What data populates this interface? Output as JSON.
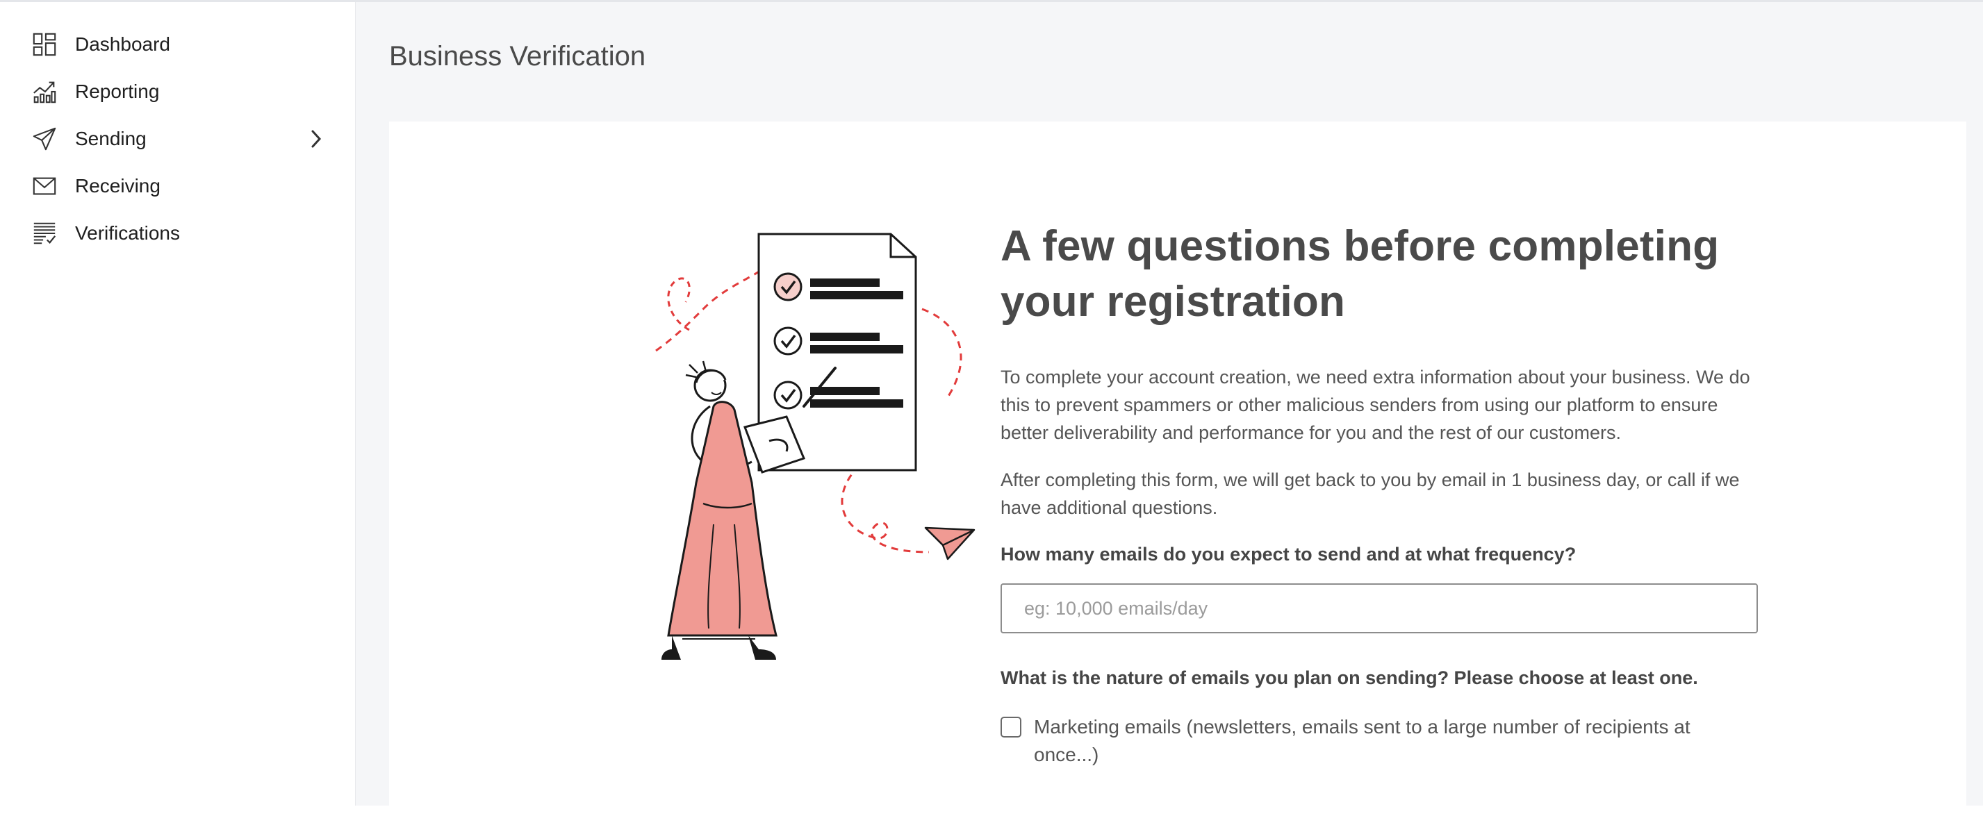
{
  "sidebar": {
    "items": [
      {
        "label": "Dashboard",
        "icon": "dashboard-icon"
      },
      {
        "label": "Reporting",
        "icon": "reporting-chart-icon"
      },
      {
        "label": "Sending",
        "icon": "paper-plane-icon",
        "has_submenu": true
      },
      {
        "label": "Receiving",
        "icon": "envelope-icon"
      },
      {
        "label": "Verifications",
        "icon": "verifications-list-icon"
      }
    ]
  },
  "page": {
    "title": "Business Verification"
  },
  "form": {
    "headline": "A few questions before completing your registration",
    "intro_1": "To complete your account creation, we need extra information about your business. We do this to prevent spammers or other malicious senders from using our platform to ensure better deliverability and performance for you and the rest of our customers.",
    "intro_2": "After completing this form, we will get back to you by email in 1 business day, or call if we have additional questions.",
    "question_1": "How many emails do you expect to send and at what frequency?",
    "question_1_placeholder": "eg: 10,000 emails/day",
    "question_1_value": "",
    "question_2": "What is the nature of emails you plan on sending? Please choose at least one.",
    "options": [
      {
        "label": "Marketing emails (newsletters, emails sent to a large number of recipients at once...)",
        "checked": false
      }
    ]
  },
  "colors": {
    "accent_pink": "#f09a93",
    "dash_red": "#e23b3b",
    "ink": "#1a1a1a"
  }
}
